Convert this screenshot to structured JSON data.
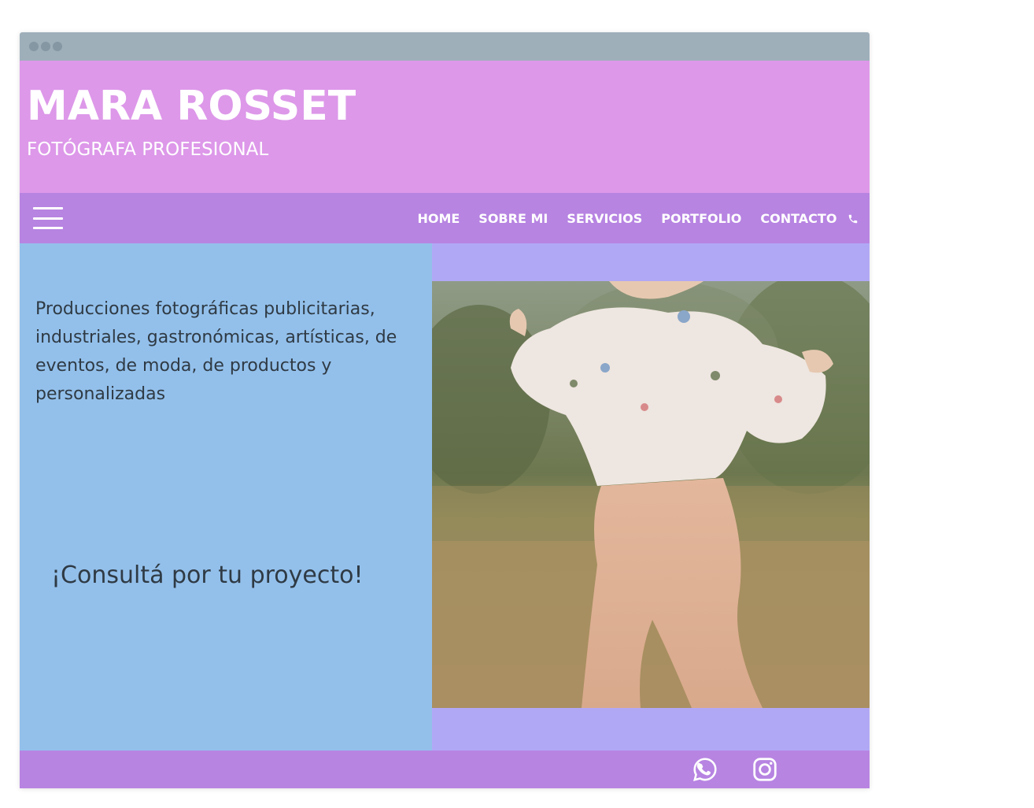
{
  "header": {
    "title": "MARA ROSSET",
    "subtitle": "FOTÓGRAFA PROFESIONAL"
  },
  "nav": {
    "items": [
      {
        "label": "HOME"
      },
      {
        "label": "SOBRE MI"
      },
      {
        "label": "SERVICIOS"
      },
      {
        "label": "PORTFOLIO"
      },
      {
        "label": "CONTACTO"
      }
    ]
  },
  "main": {
    "intro": "Producciones fotográficas publicitarias, industriales, gastronómicas, artísticas, de eventos, de moda, de productos y personalizadas",
    "cta": "¡Consultá por tu proyecto!"
  },
  "footer": {
    "icons": [
      "whatsapp-icon",
      "instagram-icon"
    ]
  },
  "colors": {
    "header_bg": "#dd98e9",
    "nav_bg": "#b784e2",
    "left_bg": "#93c0eb",
    "right_bg": "#b1a8f5",
    "titlebar_bg": "#9eafba",
    "text_dark": "#2f3a44",
    "text_light": "#ffffff"
  }
}
